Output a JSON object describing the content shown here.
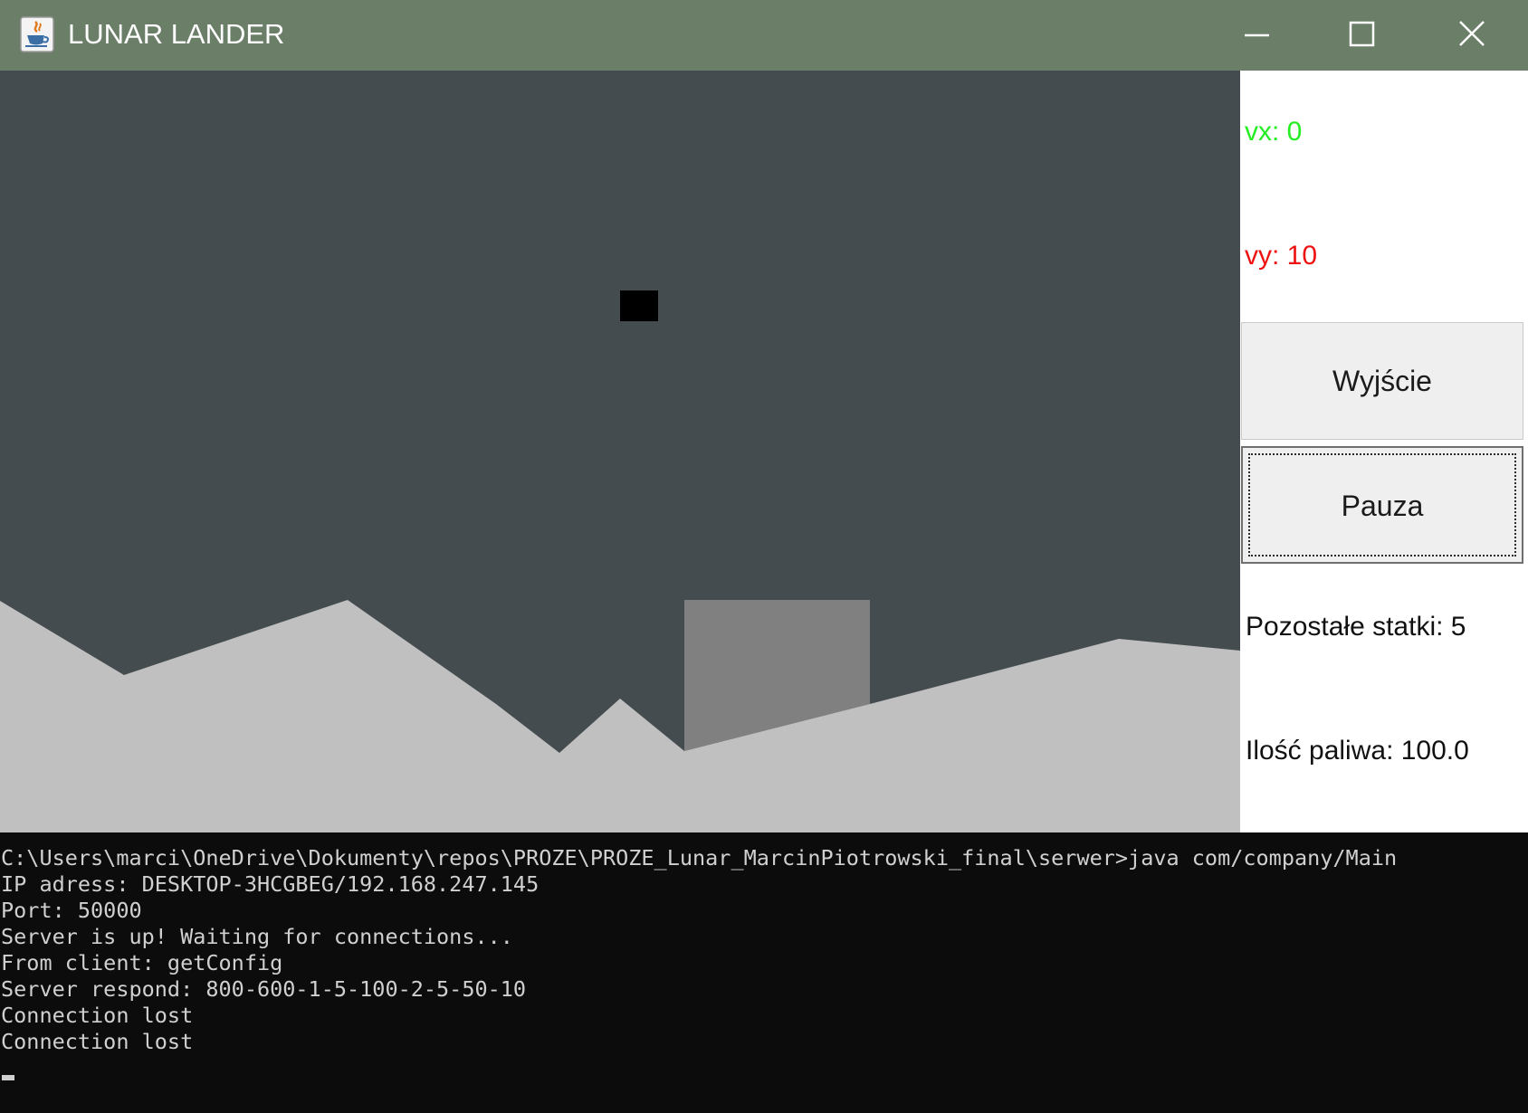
{
  "window": {
    "title": "LUNAR LANDER"
  },
  "side_panel": {
    "vx_label": "vx: 0",
    "vy_label": "vy: 10",
    "vx_color": "#22ee22",
    "vy_color": "#ee1111",
    "exit_button": "Wyjście",
    "pause_button": "Pauza",
    "ships_left": "Pozostałe statki: 5",
    "fuel": "Ilość paliwa: 100.0"
  },
  "game": {
    "sky_color": "#454c4f",
    "terrain_color": "#c0c0c0",
    "landing_pad_color": "#808080",
    "lander_color": "#000000"
  },
  "console": {
    "lines": [
      "C:\\Users\\marci\\OneDrive\\Dokumenty\\repos\\PROZE\\PROZE_Lunar_MarcinPiotrowski_final\\serwer>java com/company/Main",
      "IP adress: DESKTOP-3HCGBEG/192.168.247.145",
      "Port: 50000",
      "Server is up! Waiting for connections...",
      "From client: getConfig",
      "Server respond: 800-600-1-5-100-2-5-50-10",
      "Connection lost",
      "Connection lost"
    ]
  },
  "icons": {
    "app": "java-cup-icon",
    "minimize": "minimize-icon",
    "maximize": "maximize-icon",
    "close": "close-icon"
  }
}
